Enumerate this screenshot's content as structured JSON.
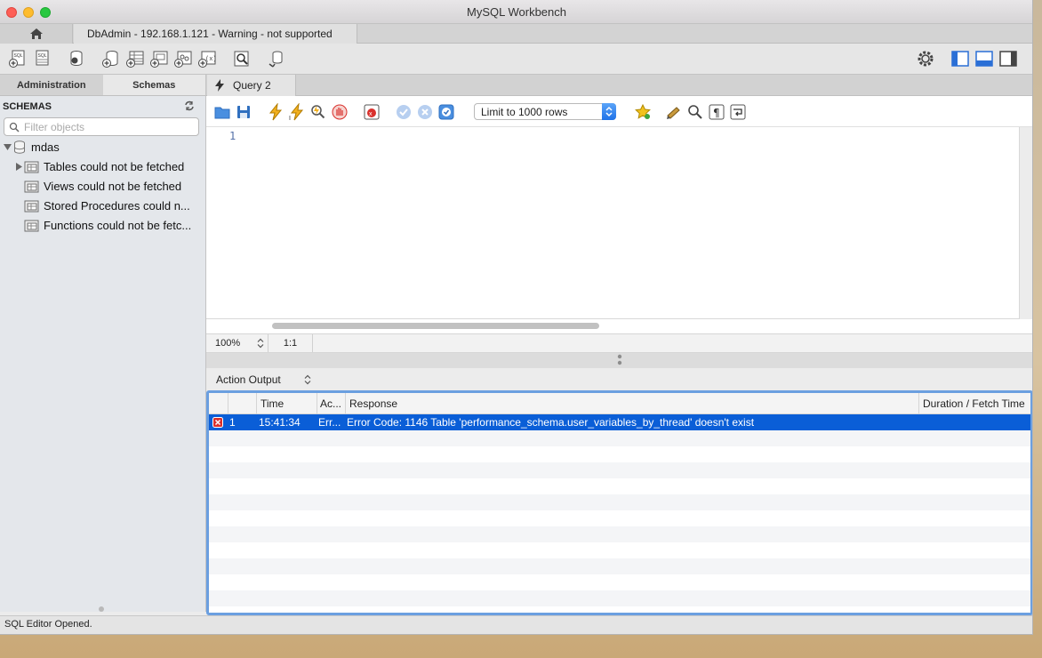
{
  "window": {
    "title": "MySQL Workbench"
  },
  "connection_tab": {
    "label": "DbAdmin - 192.168.1.121 - Warning - not supported"
  },
  "sidebar": {
    "tabs": [
      "Administration",
      "Schemas"
    ],
    "active_tab": "Schemas",
    "schemas_heading": "SCHEMAS",
    "filter_placeholder": "Filter objects",
    "tree": {
      "schema": "mdas",
      "children": [
        "Tables could not be fetched",
        "Views could not be fetched",
        "Stored Procedures could n...",
        "Functions could not be fetc..."
      ]
    }
  },
  "query_tab": {
    "label": "Query 2"
  },
  "query_toolbar": {
    "limit_select": "Limit to 1000 rows"
  },
  "editor": {
    "line_number": "1"
  },
  "editor_status": {
    "zoom": "100%",
    "cursor": "1:1"
  },
  "output": {
    "selector": "Action Output",
    "columns": [
      "",
      "Time",
      "Ac...",
      "Response",
      "Duration / Fetch Time"
    ],
    "rows": [
      {
        "num": "1",
        "time": "15:41:34",
        "action": "Err...",
        "response": "Error Code: 1146 Table 'performance_schema.user_variables_by_thread' doesn't exist",
        "duration": "",
        "status": "error"
      }
    ]
  },
  "statusbar": {
    "text": "SQL Editor Opened."
  },
  "colors": {
    "selection": "#0a5ed7",
    "error": "#d9302c",
    "grid_border": "#6b9fe0"
  }
}
